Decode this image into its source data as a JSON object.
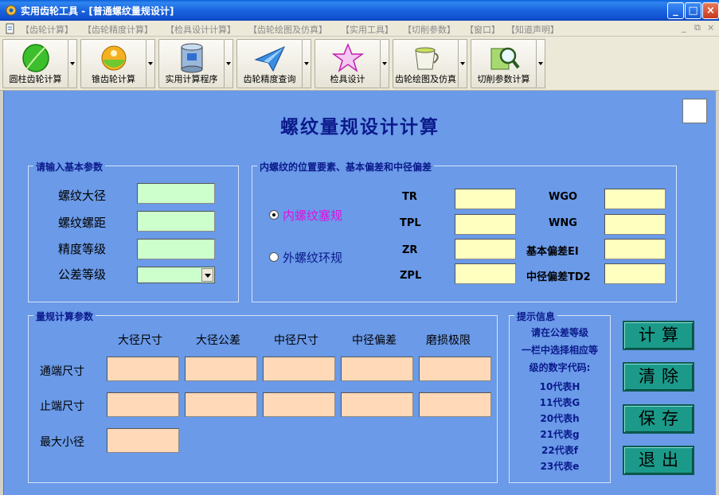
{
  "window": {
    "title": "实用齿轮工具 - [普通螺纹量规设计]",
    "controls": [
      "_",
      "□",
      "×"
    ]
  },
  "menu": {
    "items": [
      "【齿轮计算】",
      "【齿轮精度计算】",
      "【检具设计计算】",
      "【齿轮绘图及仿真】",
      "【实用工具】",
      "【切削参数】",
      "【窗口】",
      "【知道声明】"
    ],
    "mdi_controls": [
      "_",
      "⧉",
      "×"
    ]
  },
  "toolbar": {
    "buttons": [
      {
        "label": "圆柱齿轮计算",
        "icon": "leaf-icon"
      },
      {
        "label": "锥齿轮计算",
        "icon": "lime-icon"
      },
      {
        "label": "实用计算程序",
        "icon": "database-icon"
      },
      {
        "label": "齿轮精度查询",
        "icon": "paper-plane-icon"
      },
      {
        "label": "检具设计",
        "icon": "star-icon"
      },
      {
        "label": "齿轮绘图及仿真",
        "icon": "tea-cup-icon"
      },
      {
        "label": "切削参数计算",
        "icon": "magnifier-book-icon"
      }
    ]
  },
  "page_title": "螺纹量规设计计算",
  "basic_params": {
    "legend": "请输入基本参数",
    "labels": [
      "螺纹大径",
      "螺纹螺距",
      "精度等级",
      "公差等级"
    ],
    "values": [
      "",
      "",
      "",
      ""
    ]
  },
  "internal": {
    "legend": "内螺纹的位置要素、基本偏差和中径偏差",
    "radio_plug": "内螺纹塞规",
    "radio_ring": "外螺纹环规",
    "left_labels": [
      "TR",
      "TPL",
      "ZR",
      "ZPL"
    ],
    "right_labels": [
      "WGO",
      "WNG",
      "基本偏差EI",
      "中径偏差TD2"
    ]
  },
  "gauge": {
    "legend": "量规计算参数",
    "columns": [
      "大径尺寸",
      "大径公差",
      "中径尺寸",
      "中径偏差",
      "磨损极限"
    ],
    "rows": [
      "通端尺寸",
      "止端尺寸",
      "最大小径"
    ]
  },
  "hint": {
    "legend": "提示信息",
    "lines": [
      "请在公差等级",
      "一栏中选择相应等",
      "级的数字代码:",
      "10代表H",
      "11代表G",
      "20代表h",
      "21代表g",
      "22代表f",
      "23代表e"
    ]
  },
  "actions": {
    "calc": "计算",
    "clear": "清除",
    "save": "保存",
    "exit": "退出"
  },
  "colors": {
    "background": "#6a9ae8",
    "title_text": "#0b1a8c",
    "input_green": "#ccffcc",
    "input_yellow": "#ffffc0",
    "input_peach": "#ffd9b8",
    "action_button": "#1b9a8a",
    "radio_plug_text": "#e010e0",
    "radio_ring_text": "#0b1a8c"
  }
}
